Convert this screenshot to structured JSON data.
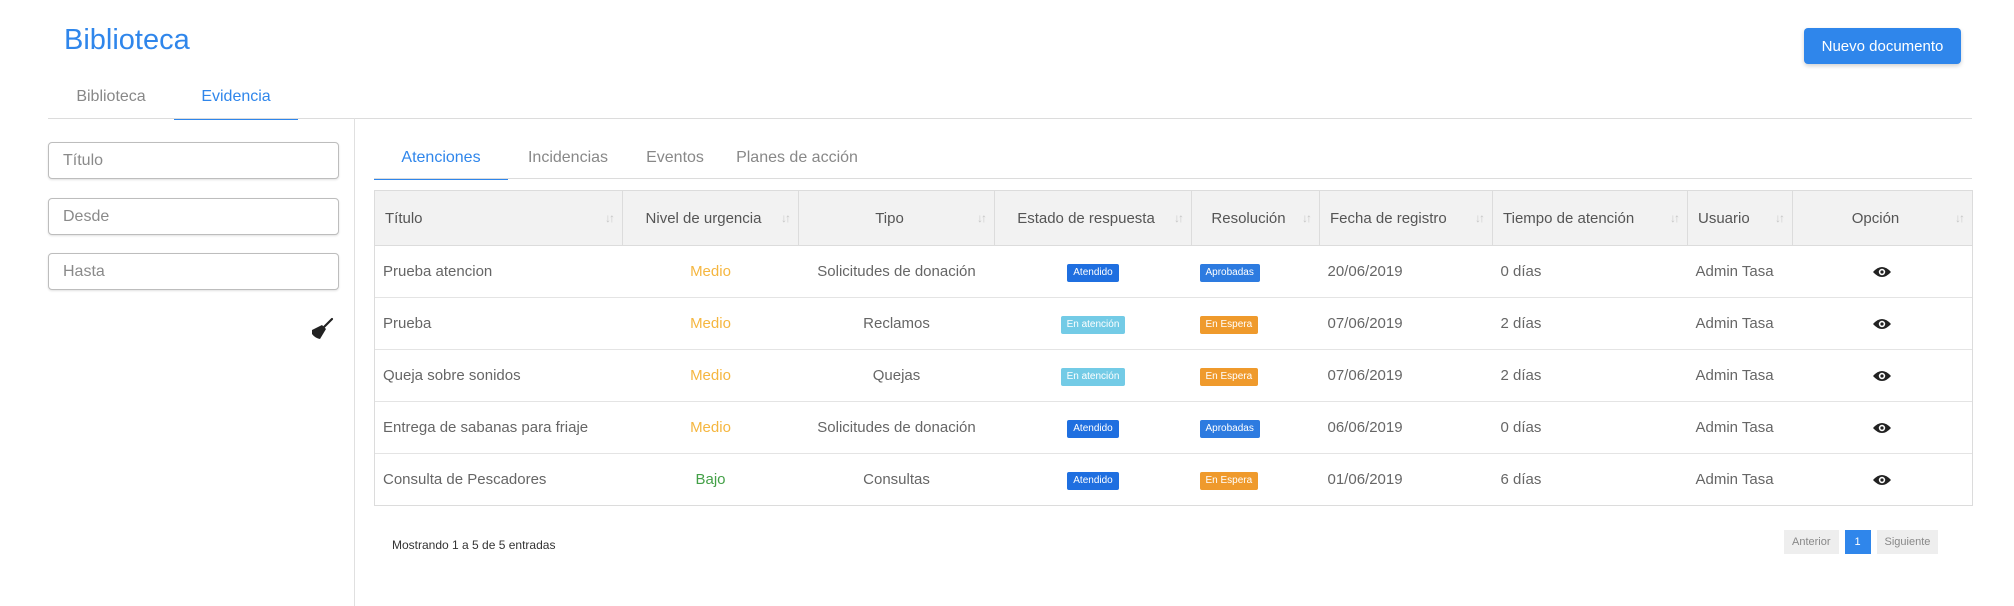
{
  "header": {
    "title": "Biblioteca",
    "new_button": "Nuevo documento"
  },
  "top_tabs": [
    {
      "label": "Biblioteca"
    },
    {
      "label": "Evidencia"
    }
  ],
  "filters": {
    "titulo_placeholder": "Título",
    "desde_placeholder": "Desde",
    "hasta_placeholder": "Hasta"
  },
  "sub_tabs": [
    {
      "label": "Atenciones"
    },
    {
      "label": "Incidencias"
    },
    {
      "label": "Eventos"
    },
    {
      "label": "Planes de acción"
    }
  ],
  "table": {
    "columns": [
      "Título",
      "Nivel de urgencia",
      "Tipo",
      "Estado de respuesta",
      "Resolución",
      "Fecha de registro",
      "Tiempo de atención",
      "Usuario",
      "Opción"
    ],
    "rows": [
      {
        "titulo": "Prueba atencion",
        "urgencia": "Medio",
        "tipo": "Solicitudes de donación",
        "estado": "Atendido",
        "resolucion": "Aprobadas",
        "fecha": "20/06/2019",
        "tiempo": "0 días",
        "usuario": "Admin Tasa"
      },
      {
        "titulo": "Prueba",
        "urgencia": "Medio",
        "tipo": "Reclamos",
        "estado": "En atención",
        "resolucion": "En Espera",
        "fecha": "07/06/2019",
        "tiempo": "2 días",
        "usuario": "Admin Tasa"
      },
      {
        "titulo": "Queja sobre sonidos",
        "urgencia": "Medio",
        "tipo": "Quejas",
        "estado": "En atención",
        "resolucion": "En Espera",
        "fecha": "07/06/2019",
        "tiempo": "2 días",
        "usuario": "Admin Tasa"
      },
      {
        "titulo": "Entrega de sabanas para friaje",
        "urgencia": "Medio",
        "tipo": "Solicitudes de donación",
        "estado": "Atendido",
        "resolucion": "Aprobadas",
        "fecha": "06/06/2019",
        "tiempo": "0 días",
        "usuario": "Admin Tasa"
      },
      {
        "titulo": "Consulta de Pescadores",
        "urgencia": "Bajo",
        "tipo": "Consultas",
        "estado": "Atendido",
        "resolucion": "En Espera",
        "fecha": "01/06/2019",
        "tiempo": "6 días",
        "usuario": "Admin Tasa"
      }
    ]
  },
  "footer": {
    "entries_text": "Mostrando 1 a 5 de 5 entradas"
  },
  "pagination": {
    "prev": "Anterior",
    "current": "1",
    "next": "Siguiente"
  },
  "colors": {
    "primary": "#2f86eb",
    "urgency_medio": "#f5b63f",
    "urgency_bajo": "#43a047",
    "status_atendido": "#1f6fe0",
    "status_en_atencion": "#73cbe6",
    "res_aprobadas": "#2d7be0",
    "res_en_espera": "#ef9a2c"
  },
  "icons": {
    "clear": "broom-icon",
    "view": "eye-icon",
    "sort": "sort-arrows-icon"
  }
}
